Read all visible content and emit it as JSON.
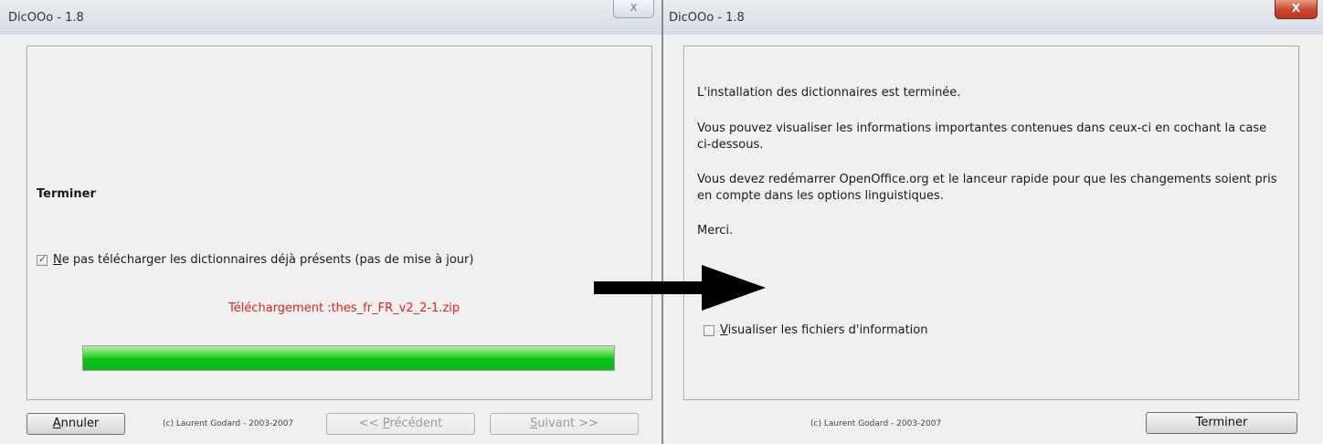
{
  "left_window": {
    "title": "DicOOo - 1.8",
    "close_label": "X",
    "heading": "Terminer",
    "checkbox_label_underlined": "N",
    "checkbox_label_rest": "e pas télécharger les dictionnaires déjà présents (pas de mise à jour)",
    "checkbox_checked": true,
    "download_status": "Téléchargement :thes_fr_FR_v2_2-1.zip",
    "progress_fraction": 1.0,
    "cancel_underlined": "A",
    "cancel_rest": "nnuler",
    "copyright": "(c) Laurent Godard - 2003-2007",
    "previous_prefix": "<< ",
    "previous_underlined": "P",
    "previous_rest": "récédent",
    "next_underlined": "S",
    "next_rest": "uivant >>"
  },
  "right_window": {
    "title": "DicOOo - 1.8",
    "close_label": "X",
    "para1": "L'installation des dictionnaires est terminée.",
    "para2": "Vous pouvez visualiser les informations importantes contenues dans ceux-ci en cochant la case ci-dessous.",
    "para3": "Vous devez redémarrer OpenOffice.org et le lanceur rapide pour que les changements soient pris en compte dans les options linguistiques.",
    "para4": "Merci.",
    "checkbox_label_underlined": "V",
    "checkbox_label_rest": "isualiser les fichiers d'information",
    "checkbox_checked": false,
    "copyright": "(c) Laurent Godard - 2003-2007",
    "finish_label": "Terminer"
  },
  "colors": {
    "status_red": "#e8211c",
    "progress_green": "#05c316",
    "close_red": "#c7462c"
  },
  "icons": [
    "check-icon",
    "close-icon",
    "right-arrow-icon"
  ]
}
